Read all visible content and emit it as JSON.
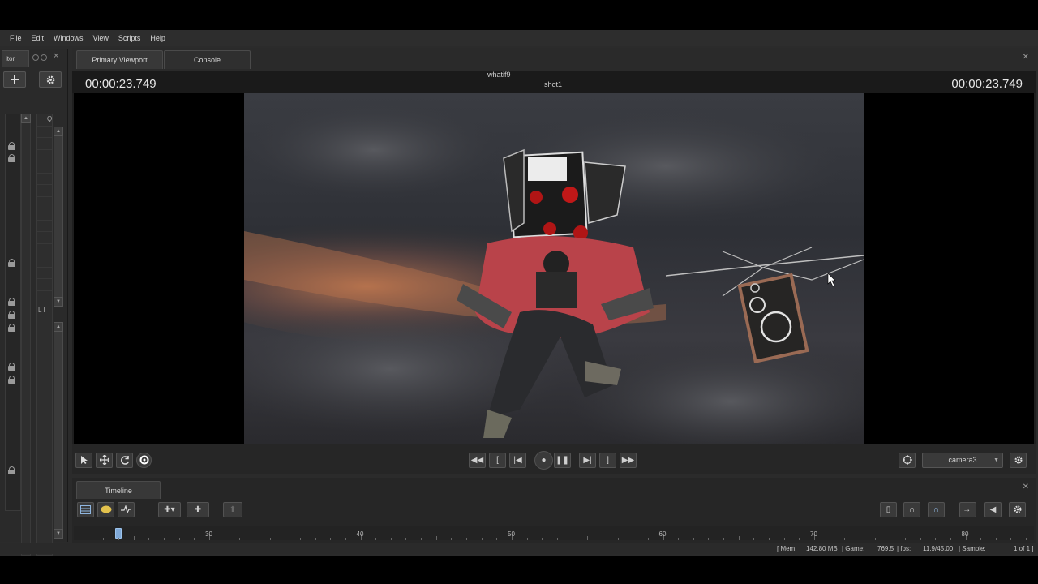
{
  "menu": [
    "File",
    "Edit",
    "Windows",
    "View",
    "Scripts",
    "Help"
  ],
  "left_dock": {
    "tab_label": "itor",
    "filter_label": "Q",
    "mini_label": "L I"
  },
  "viewport": {
    "tabs": [
      {
        "label": "Primary Viewport",
        "active": true
      },
      {
        "label": "Console",
        "active": false
      }
    ],
    "timecode_left": "00:00:23.749",
    "timecode_right": "00:00:23.749",
    "map_name": "whatif9",
    "shot_name": "shot1",
    "camera": "camera3"
  },
  "timeline": {
    "tab_label": "Timeline",
    "tick_labels": [
      "30",
      "40",
      "50",
      "60",
      "70",
      "80"
    ],
    "playhead_frame": 24
  },
  "status": {
    "mem_label": "[ Mem:",
    "mem_value": "142.80 MB",
    "game_label": "| Game:",
    "game_value": "769.5",
    "fps_label": "| fps:",
    "fps_value": "11.9/45.00",
    "sample_label": "| Sample:",
    "sample_value": "1 of 1 ]"
  },
  "icons": {
    "transport": [
      "rewind-icon",
      "mark-in-icon",
      "step-back-icon",
      "record-icon",
      "pause-icon",
      "step-forward-icon",
      "mark-out-icon",
      "fast-forward-icon"
    ],
    "tools": [
      "select-arrow-icon",
      "move-icon",
      "rotate-icon",
      "orbit-icon"
    ]
  },
  "colors": {
    "background": "#2b2b2b",
    "viewport_bg": "#000000",
    "playhead": "#7fa8d6",
    "timecode": "#e8e8e8"
  }
}
